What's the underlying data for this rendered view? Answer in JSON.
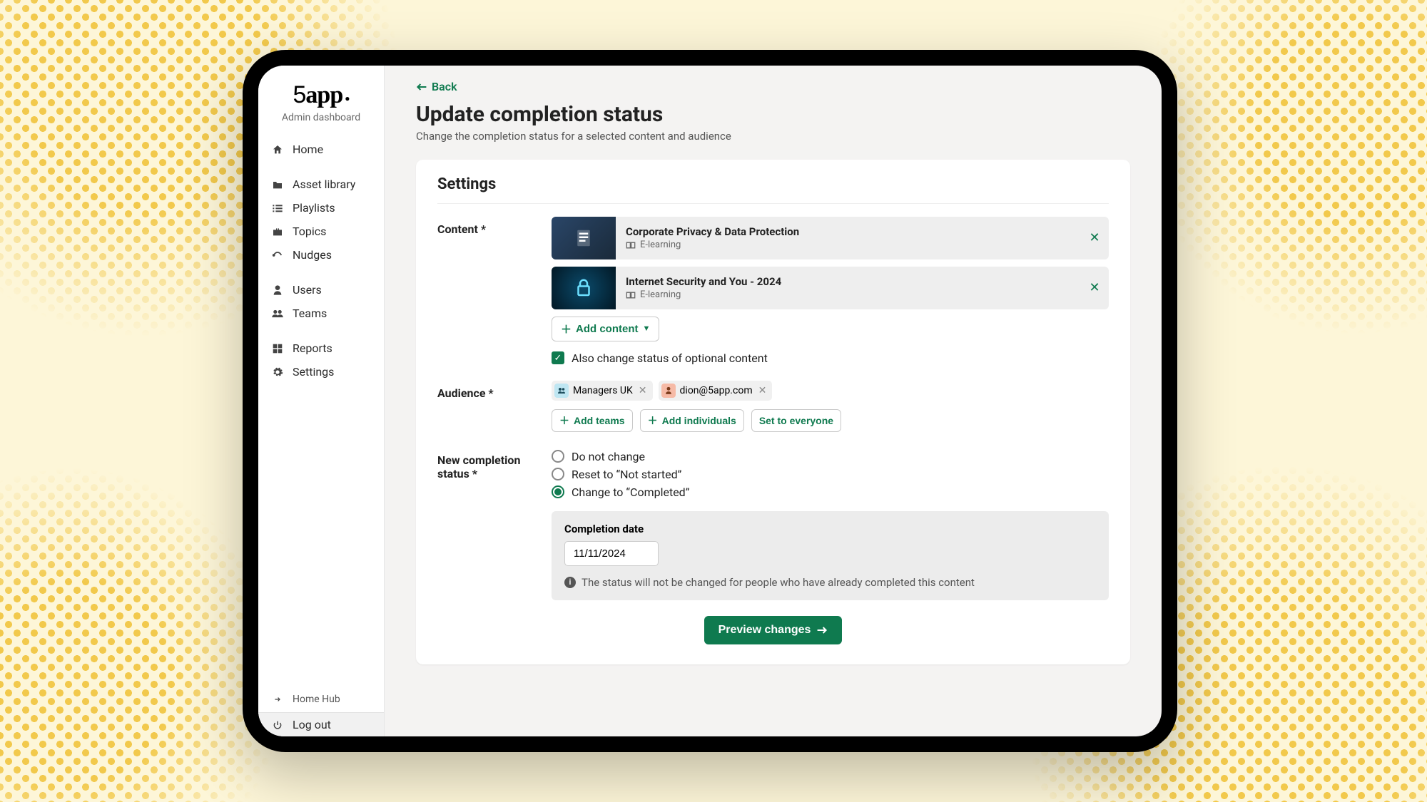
{
  "brand": {
    "name": "5app",
    "subtitle": "Admin dashboard"
  },
  "sidebar": {
    "groups": [
      [
        {
          "icon": "home",
          "label": "Home"
        }
      ],
      [
        {
          "icon": "folder",
          "label": "Asset library"
        },
        {
          "icon": "list",
          "label": "Playlists"
        },
        {
          "icon": "briefcase",
          "label": "Topics"
        },
        {
          "icon": "bell",
          "label": "Nudges"
        }
      ],
      [
        {
          "icon": "user",
          "label": "Users"
        },
        {
          "icon": "users",
          "label": "Teams"
        }
      ],
      [
        {
          "icon": "grid",
          "label": "Reports"
        },
        {
          "icon": "gear",
          "label": "Settings"
        }
      ]
    ],
    "footer": {
      "hub": "Home Hub",
      "logout": "Log out"
    }
  },
  "header": {
    "back": "Back",
    "title": "Update completion status",
    "subtitle": "Change the completion status for a selected content and audience"
  },
  "card": {
    "heading": "Settings",
    "content": {
      "label": "Content *",
      "items": [
        {
          "title": "Corporate Privacy & Data Protection",
          "type": "E-learning",
          "thumb": "doc"
        },
        {
          "title": "Internet Security and You - 2024",
          "type": "E-learning",
          "thumb": "sec"
        }
      ],
      "add_btn": "Add content",
      "optional_checkbox": "Also change status of optional content",
      "optional_checked": true
    },
    "audience": {
      "label": "Audience *",
      "chips": [
        {
          "kind": "team",
          "label": "Managers UK"
        },
        {
          "kind": "user",
          "label": "dion@5app.com"
        }
      ],
      "add_teams": "Add teams",
      "add_individuals": "Add individuals",
      "set_everyone": "Set to everyone"
    },
    "status": {
      "label": "New completion status *",
      "options": [
        {
          "label": "Do not change",
          "checked": false
        },
        {
          "label": "Reset to “Not started”",
          "checked": false
        },
        {
          "label": "Change to “Completed”",
          "checked": true
        }
      ],
      "completion": {
        "label": "Completion date",
        "value": "11/11/2024",
        "note": "The status will not be changed for people who have already completed this content"
      }
    },
    "preview_btn": "Preview changes"
  },
  "colors": {
    "accent": "#0f7a4f"
  }
}
